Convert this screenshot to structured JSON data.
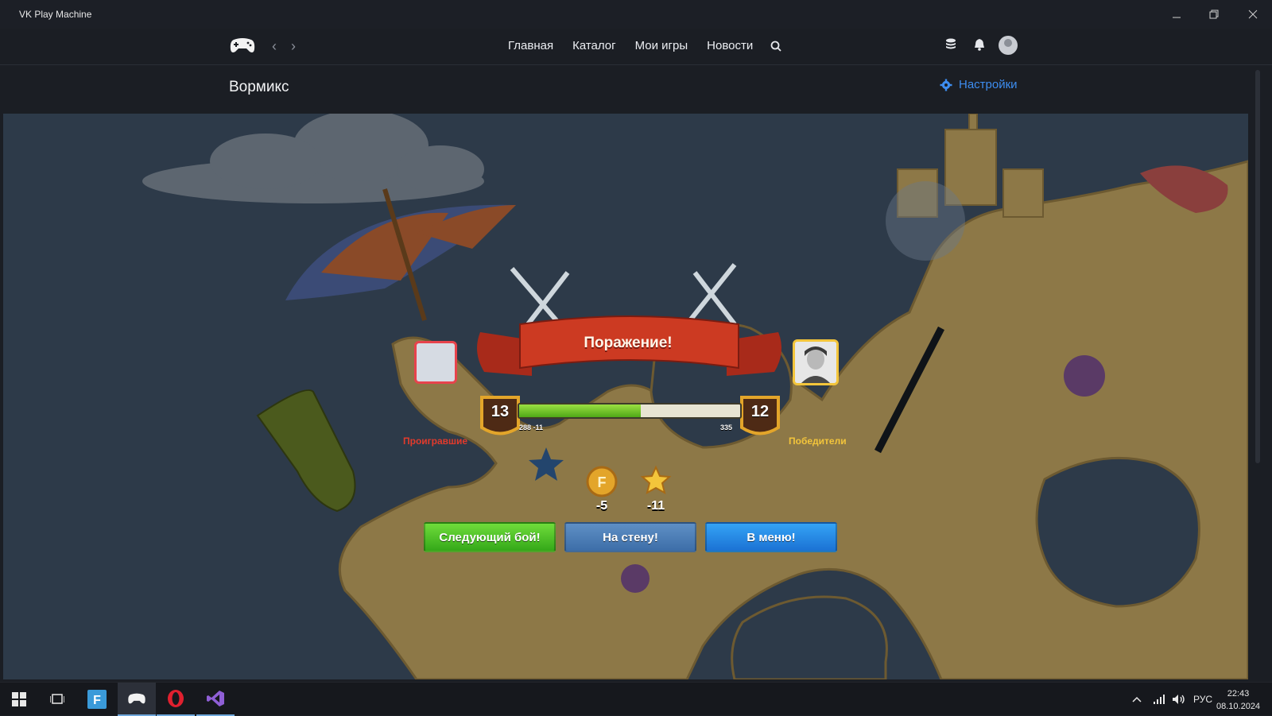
{
  "window": {
    "title": "VK Play Machine"
  },
  "nav": {
    "links": [
      "Главная",
      "Каталог",
      "Мои игры",
      "Новости"
    ]
  },
  "page": {
    "title": "Вормикс",
    "settings_label": "Настройки"
  },
  "game": {
    "result_title": "Поражение!",
    "losers_label": "Проигравшие",
    "winners_label": "Победители",
    "level_left": "13",
    "level_right": "12",
    "xp_left_label": "288 -11",
    "xp_right_label": "335",
    "xp_progress": 0.55,
    "rewards": {
      "coins": "-5",
      "rating": "-11"
    },
    "buttons": {
      "next": "Следующий бой!",
      "wall": "На стену!",
      "menu": "В меню!"
    }
  },
  "taskbar": {
    "apps": [
      "start",
      "task-view",
      "f-app",
      "vk-play",
      "opera",
      "visual-studio"
    ],
    "tray_language": "РУС",
    "time": "22:43",
    "date": "08.10.2024"
  },
  "colors": {
    "accent": "#3d8df0",
    "loss_red": "#e23a2c",
    "win_gold": "#f3c53b",
    "btn_green": "#4fc126",
    "btn_blue": "#1f86e6"
  }
}
